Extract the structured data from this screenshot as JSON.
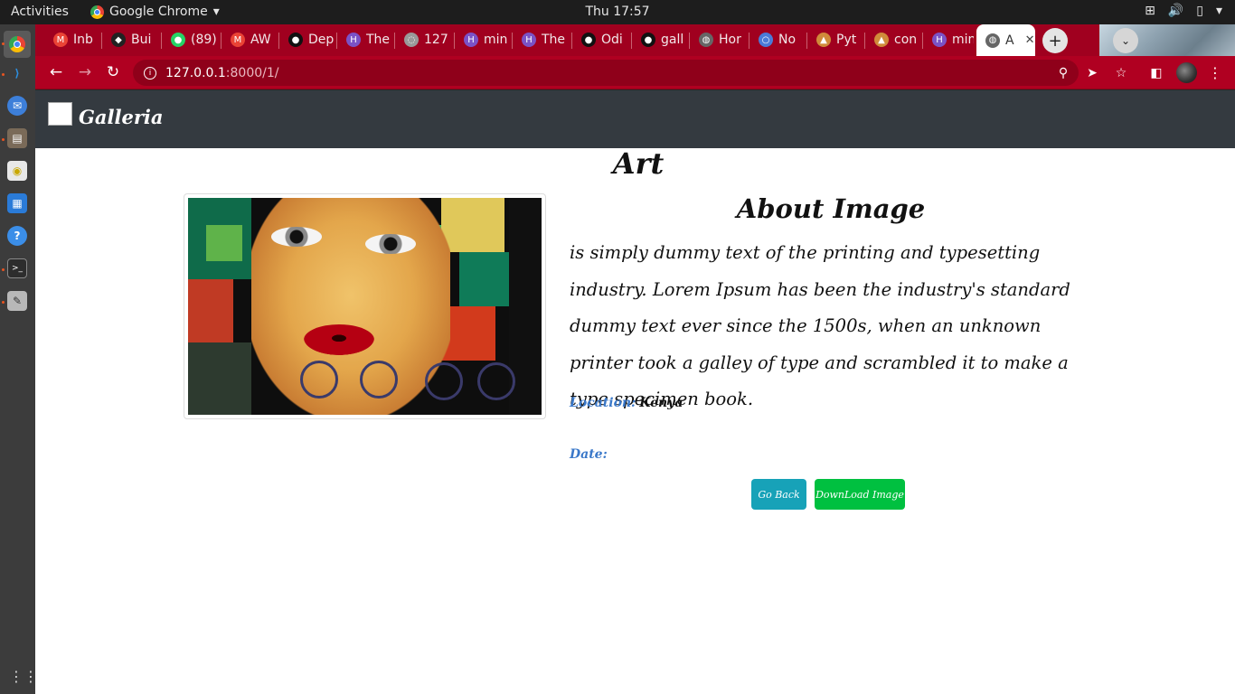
{
  "topbar": {
    "activities": "Activities",
    "app_name": "Google Chrome",
    "clock": "Thu 17:57"
  },
  "tabs": [
    {
      "label": "Inb",
      "favicon": "gmail-icon",
      "color": "#ea4335"
    },
    {
      "label": "Bui",
      "favicon": "builder-icon",
      "color": "#222222"
    },
    {
      "label": "(89)",
      "favicon": "whatsapp-icon",
      "color": "#25d366"
    },
    {
      "label": "AW",
      "favicon": "gmail-icon",
      "color": "#ea4335"
    },
    {
      "label": "Dep",
      "favicon": "github-icon",
      "color": "#111111"
    },
    {
      "label": "The",
      "favicon": "heroku-icon",
      "color": "#7b52c6"
    },
    {
      "label": "127",
      "favicon": "loading-icon",
      "color": "#999999"
    },
    {
      "label": "min",
      "favicon": "heroku-icon",
      "color": "#7b52c6"
    },
    {
      "label": "The",
      "favicon": "heroku-icon",
      "color": "#7b52c6"
    },
    {
      "label": "Odi",
      "favicon": "github-icon",
      "color": "#111111"
    },
    {
      "label": "gall",
      "favicon": "github-icon",
      "color": "#111111"
    },
    {
      "label": "Hor",
      "favicon": "globe-icon",
      "color": "#666666"
    },
    {
      "label": "No",
      "favicon": "circle-icon",
      "color": "#4a7bd8"
    },
    {
      "label": "Pyt",
      "favicon": "python-icon",
      "color": "#d08a3a"
    },
    {
      "label": "con",
      "favicon": "python-icon",
      "color": "#d08a3a"
    },
    {
      "label": "min",
      "favicon": "heroku-icon",
      "color": "#7b52c6"
    },
    {
      "label": "A",
      "favicon": "globe-icon",
      "color": "#666666",
      "active": true
    }
  ],
  "omnibox": {
    "host": "127.0.0.1",
    "path": ":8000/1/"
  },
  "site": {
    "brand": "Galleria"
  },
  "content": {
    "category": "Art",
    "about_title": "About Image",
    "description": "is simply dummy text of the printing and typesetting industry. Lorem Ipsum has been the industry's standard dummy text ever since the 1500s, when an unknown printer took a galley of type and scrambled it to make a type specimen book.",
    "location_label": "Location:",
    "location_value": "Kenya",
    "date_label": "Date:",
    "date_value": ""
  },
  "buttons": {
    "back": "Go Back",
    "download": "DownLoad Image"
  },
  "colors": {
    "tab_strip": "#a0001f",
    "toolbar": "#b00021",
    "navbar": "#343a40",
    "meta_label": "#3a78c9",
    "btn_back": "#17a2b8",
    "btn_download": "#00c040"
  }
}
